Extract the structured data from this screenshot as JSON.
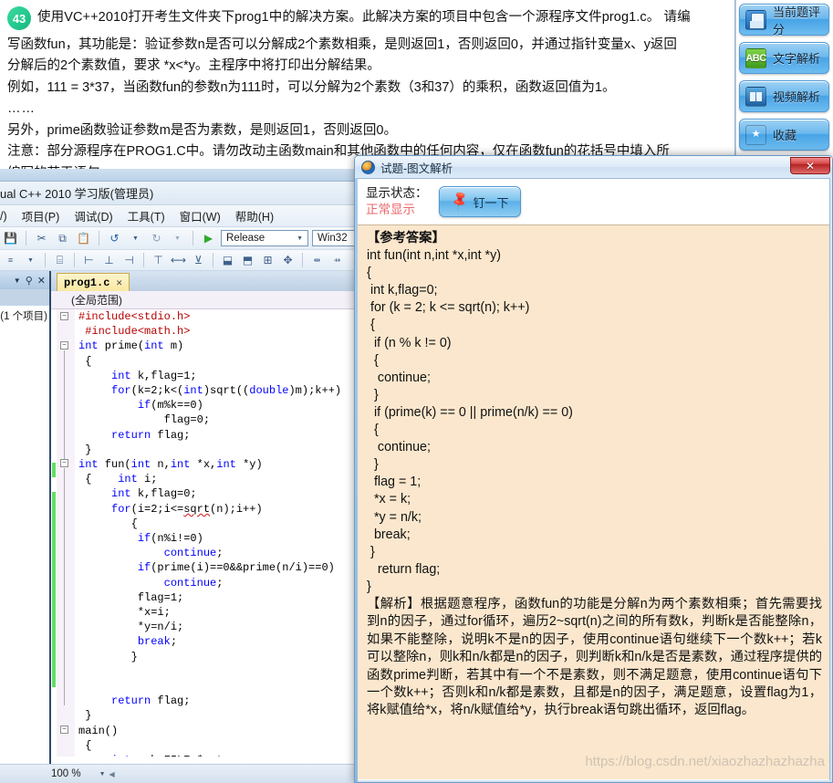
{
  "question": {
    "number": "43",
    "first_line": "使用VC++2010打开考生文件夹下prog1中的解决方案。此解决方案的项目中包含一个源程序文件prog1.c。 请编",
    "lines": [
      "写函数fun，其功能是：验证参数n是否可以分解成2个素数相乘，是则返回1，否则返回0，并通过指针变量x、y返回",
      "分解后的2个素数值，要求 *x<*y。主程序中将打印出分解结果。",
      "例如，111 = 3*37，当函数fun的参数n为111时，可以分解为2个素数（3和37）的乘积，函数返回值为1。",
      "……",
      "另外，prime函数验证参数m是否为素数，是则返回1，否则返回0。",
      "注意：部分源程序在PROG1.C中。请勿改动主函数main和其他函数中的任何内容，仅在函数fun的花括号中填入所",
      "编写的若干语句。"
    ]
  },
  "rail": {
    "buttons": [
      {
        "label": "当前题评分",
        "icon": "save-icon"
      },
      {
        "label": "文字解析",
        "icon": "abc-text-icon"
      },
      {
        "label": "视频解析",
        "icon": "video-icon"
      },
      {
        "label": "收藏",
        "icon": "star-icon"
      }
    ]
  },
  "vs": {
    "title": "ual C++ 2010 学习版(管理员)",
    "menus": [
      "/)",
      "项目(P)",
      "调试(D)",
      "工具(T)",
      "窗口(W)",
      "帮助(H)"
    ],
    "config": "Release",
    "platform": "Win32",
    "explorer": {
      "project_count": "(1 个项目)"
    },
    "tab": {
      "name": "prog1.c",
      "close": "✕"
    },
    "scope": "(全局范围)",
    "zoom": "100 %",
    "code_lines": [
      "#include<stdio.h>",
      " #include<math.h>",
      "int prime(int m)",
      " {",
      "     int k,flag=1;",
      "     for(k=2;k<(int)sqrt((double)m);k++)",
      "         if(m%k==0)",
      "             flag=0;",
      "     return flag;",
      " }",
      "int fun(int n,int *x,int *y)",
      " {    int i;",
      "     int k,flag=0;",
      "     for(i=2;i<=sqrt(n);i++)",
      "        {",
      "         if(n%i!=0)",
      "             continue;",
      "         if(prime(i)==0&&prime(n/i)==0)",
      "             continue;",
      "         flag=1;",
      "         *x=i;",
      "         *y=n/i;",
      "         break;",
      "        }",
      "",
      "",
      "     return flag;",
      " }",
      "main()",
      " {",
      "     int a,b;FILE *out ;"
    ]
  },
  "dialog": {
    "title": "试题-图文解析",
    "close_label": "✕",
    "status_label": "显示状态：",
    "status_value": "正常显示",
    "pin_button": "钉一下",
    "answer_heading": "【参考答案】",
    "answer_code": [
      "int fun(int n,int *x,int *y)",
      "{",
      " int k,flag=0;",
      " for (k = 2; k <= sqrt(n); k++)",
      " {",
      "  if (n % k != 0)",
      "  {",
      "   continue;",
      "  }",
      "  if (prime(k) == 0 || prime(n/k) == 0)",
      "  {",
      "   continue;",
      "  }",
      "  flag = 1;",
      "  *x = k;",
      "  *y = n/k;",
      "  break;",
      " }",
      "   return flag;",
      "}"
    ],
    "explanation": "【解析】根据题意程序，函数fun的功能是分解n为两个素数相乘；首先需要找到n的因子，通过for循环，遍历2~sqrt(n)之间的所有数k，判断k是否能整除n，如果不能整除，说明k不是n的因子，使用continue语句继续下一个数k++；若k可以整除n，则k和n/k都是n的因子，则判断k和n/k是否是素数，通过程序提供的函数prime判断，若其中有一个不是素数，则不满足题意，使用continue语句下一个数k++；否则k和n/k都是素数，且都是n的因子，满足题意，设置flag为1，将k赋值给*x，将n/k赋值给*y，执行break语句跳出循环，返回flag。",
    "watermark": "https://blog.csdn.net/xiaozhazhazhazha"
  },
  "colors": {
    "badge_green": "#21c98d",
    "answer_bg": "#fbe7cd",
    "status_red": "#e8686d",
    "button_blue": "#6cb8ed"
  }
}
